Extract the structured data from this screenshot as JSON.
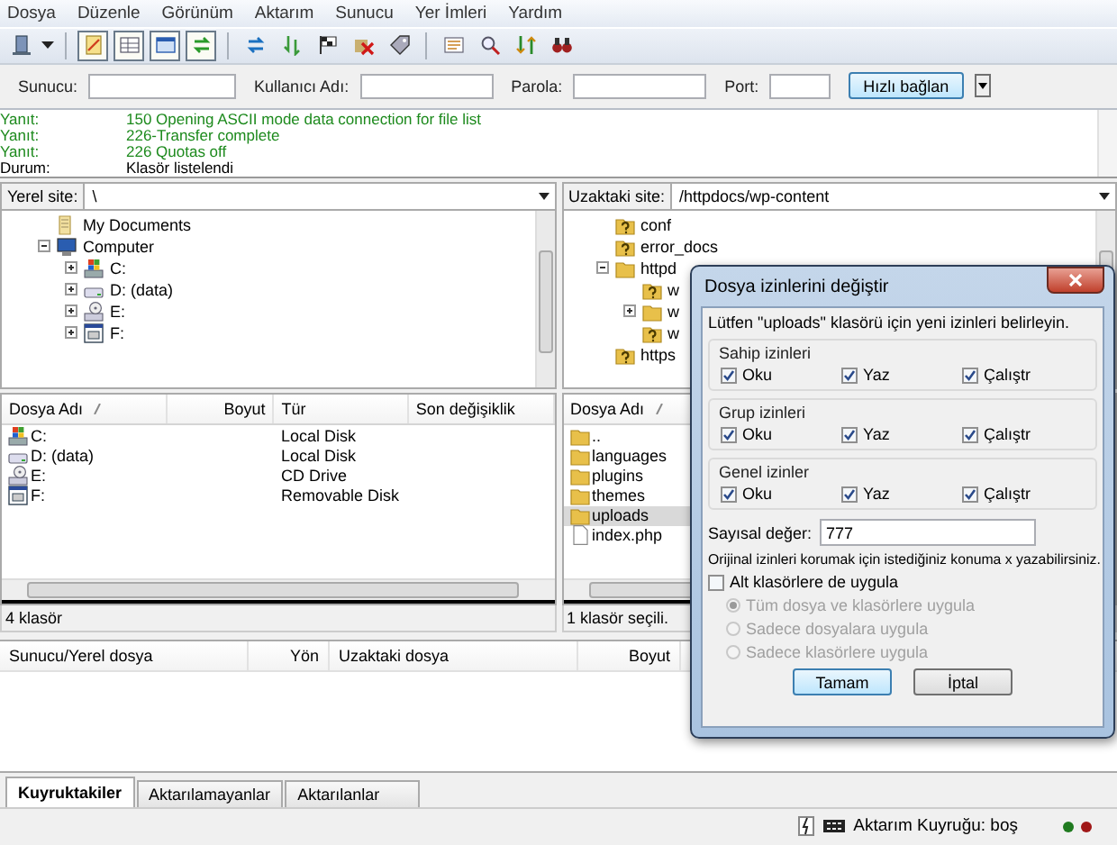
{
  "menu": [
    "Dosya",
    "Düzenle",
    "Görünüm",
    "Aktarım",
    "Sunucu",
    "Yer İmleri",
    "Yardım"
  ],
  "quickconnect": {
    "fields": [
      {
        "label": "Sunucu:"
      },
      {
        "label": "Kullanıcı Adı:"
      },
      {
        "label": "Parola:"
      },
      {
        "label": "Port:"
      }
    ],
    "button": "Hızlı bağlan"
  },
  "log": [
    {
      "kind": "response",
      "label": "Yanıt:",
      "text": "150 Opening ASCII mode data connection for file list"
    },
    {
      "kind": "response",
      "label": "Yanıt:",
      "text": "226-Transfer complete"
    },
    {
      "kind": "response",
      "label": "Yanıt:",
      "text": "226 Quotas off"
    },
    {
      "kind": "status",
      "label": "Durum:",
      "text": "Klasör listelendi"
    }
  ],
  "local": {
    "site_label": "Yerel site:",
    "path": "\\",
    "tree": [
      {
        "label": "My Documents",
        "kind": "documents"
      },
      {
        "label": "Computer",
        "kind": "computer",
        "expanded": true,
        "children": [
          {
            "label": "C:",
            "kind": "windows-drive",
            "expanded": false
          },
          {
            "label": "D: (data)",
            "kind": "drive",
            "expanded": false
          },
          {
            "label": "E:",
            "kind": "cd",
            "expanded": false
          },
          {
            "label": "F:",
            "kind": "removable",
            "expanded": false
          }
        ]
      }
    ],
    "columns": [
      "Dosya Adı",
      "Boyut",
      "Tür",
      "Son değişiklik"
    ],
    "rows": [
      {
        "name": "C:",
        "kind": "windows-drive",
        "type": "Local Disk",
        "selected": false
      },
      {
        "name": "D: (data)",
        "kind": "drive",
        "type": "Local Disk",
        "selected": false
      },
      {
        "name": "E:",
        "kind": "cd",
        "type": "CD Drive",
        "selected": false
      },
      {
        "name": "F:",
        "kind": "removable",
        "type": "Removable Disk",
        "selected": false
      }
    ],
    "status": "4 klasör"
  },
  "remote": {
    "site_label": "Uzaktaki site:",
    "path": "/httpdocs/wp-content",
    "tree": [
      {
        "label": "conf",
        "kind": "unknown"
      },
      {
        "label": "error_docs",
        "kind": "unknown"
      },
      {
        "label": "httpd",
        "kind": "folder",
        "expanded": true,
        "children": [
          {
            "label": "w",
            "kind": "unknown"
          },
          {
            "label": "w",
            "kind": "folder",
            "expanded": false
          },
          {
            "label": "w",
            "kind": "unknown"
          }
        ]
      },
      {
        "label": "https",
        "kind": "unknown"
      }
    ],
    "columns": [
      "Dosya Adı"
    ],
    "rows": [
      {
        "name": "..",
        "kind": "folder",
        "selected": false
      },
      {
        "name": "languages",
        "kind": "folder",
        "selected": false
      },
      {
        "name": "plugins",
        "kind": "folder",
        "selected": false
      },
      {
        "name": "themes",
        "kind": "folder",
        "selected": false
      },
      {
        "name": "uploads",
        "kind": "folder",
        "selected": true
      },
      {
        "name": "index.php",
        "kind": "file",
        "selected": false
      }
    ],
    "status": "1 klasör seçili."
  },
  "queue": {
    "columns": [
      "Sunucu/Yerel dosya",
      "Yön",
      "Uzaktaki dosya",
      "Boyut"
    ]
  },
  "tabs": [
    {
      "label": "Kuyruktakiler",
      "selected": true
    },
    {
      "label": "Aktarılamayanlar",
      "selected": false
    },
    {
      "label": "Aktarılanlar",
      "selected": false
    }
  ],
  "status_bar": {
    "text": "Aktarım Kuyruğu: boş",
    "lights": [
      {
        "color": "#1f7a1f"
      },
      {
        "color": "#a01818"
      }
    ]
  },
  "dialog": {
    "title": "Dosya izinlerini değiştir",
    "intro": "Lütfen \"uploads\" klasörü için yeni izinleri belirleyin.",
    "groups": [
      {
        "title": "Sahip izinleri",
        "perms": [
          {
            "label": "Oku",
            "checked": true
          },
          {
            "label": "Yaz",
            "checked": true
          },
          {
            "label": "Çalıştr",
            "checked": true
          }
        ]
      },
      {
        "title": "Grup izinleri",
        "perms": [
          {
            "label": "Oku",
            "checked": true
          },
          {
            "label": "Yaz",
            "checked": true
          },
          {
            "label": "Çalıştr",
            "checked": true
          }
        ]
      },
      {
        "title": "Genel izinler",
        "perms": [
          {
            "label": "Oku",
            "checked": true
          },
          {
            "label": "Yaz",
            "checked": true
          },
          {
            "label": "Çalıştr",
            "checked": true
          }
        ]
      }
    ],
    "numeric_label": "Sayısal değer:",
    "numeric_value": "777",
    "hint": "Orijinal izinleri korumak için istediğiniz konuma x yazabilirsiniz.",
    "recurse": {
      "label": "Alt klasörlere de uygula",
      "checked": false
    },
    "options": [
      {
        "label": "Tüm dosya ve klasörlere uygula",
        "selected": true,
        "disabled": true
      },
      {
        "label": "Sadece dosyalara uygula",
        "selected": false,
        "disabled": true
      },
      {
        "label": "Sadece klasörlere uygula",
        "selected": false,
        "disabled": true
      }
    ],
    "buttons": [
      {
        "label": "Tamam",
        "default": true
      },
      {
        "label": "İptal",
        "default": false
      }
    ]
  }
}
